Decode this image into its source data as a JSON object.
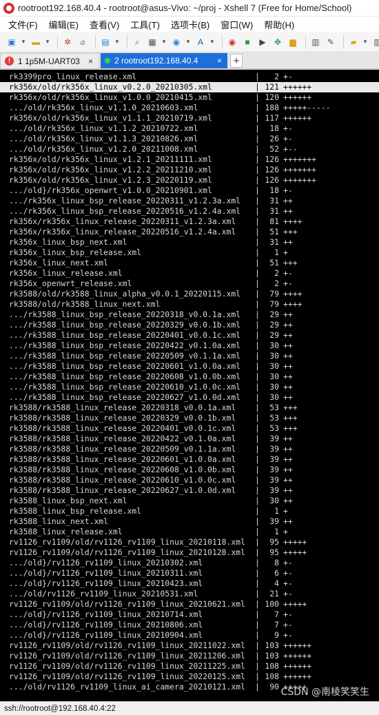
{
  "window": {
    "title": "rootroot192.168.40.4 - rootroot@asus-Vivo: ~/proj - Xshell 7 (Free for Home/School)"
  },
  "menu": [
    "文件(F)",
    "编辑(E)",
    "查看(V)",
    "工具(T)",
    "选项卡(B)",
    "窗口(W)",
    "帮助(H)"
  ],
  "toolbar": [
    {
      "name": "new-session-icon",
      "glyph": "▣",
      "color": "#2e7bcf",
      "caret": true
    },
    {
      "name": "open-folder-icon",
      "glyph": "▬",
      "color": "#e0a020",
      "caret": true
    },
    {
      "sep": true
    },
    {
      "name": "reconnect-icon",
      "glyph": "✲",
      "color": "#c0392b"
    },
    {
      "name": "disconnect-icon",
      "glyph": "⌀",
      "color": "#7f8c8d"
    },
    {
      "sep": true
    },
    {
      "name": "properties-icon",
      "glyph": "▤",
      "color": "#2e7bcf",
      "caret": true
    },
    {
      "sep": true
    },
    {
      "name": "find-icon",
      "glyph": "⌕",
      "color": "#555555"
    },
    {
      "name": "print-icon",
      "glyph": "▦",
      "color": "#555555",
      "caret": true
    },
    {
      "name": "globe-icon",
      "glyph": "◉",
      "color": "#2e86de",
      "caret": true
    },
    {
      "name": "font-icon",
      "glyph": "A",
      "color": "#1a5fb4",
      "caret": true
    },
    {
      "sep": true
    },
    {
      "name": "xshell-icon",
      "glyph": "◉",
      "color": "#d32f2f"
    },
    {
      "name": "xftp-icon",
      "glyph": "■",
      "color": "#2e9d3a"
    },
    {
      "name": "script-icon",
      "glyph": "▶",
      "color": "#444444"
    },
    {
      "name": "fullscreen-icon",
      "glyph": "✥",
      "color": "#1f9d55"
    },
    {
      "name": "lock-icon",
      "glyph": "▆",
      "color": "#e0a020"
    },
    {
      "sep": true
    },
    {
      "name": "keyboard-icon",
      "glyph": "▥",
      "color": "#555555"
    },
    {
      "name": "pen-icon",
      "glyph": "✎",
      "color": "#555555"
    },
    {
      "sep": true
    },
    {
      "name": "add-session-icon",
      "glyph": "▰",
      "color": "#e0a020",
      "caret": true
    },
    {
      "name": "layout-icon",
      "glyph": "▥",
      "color": "#555555",
      "caret": true
    }
  ],
  "tabs": [
    {
      "label": "1 1p5M-UART03",
      "close": "×",
      "warning": "!"
    },
    {
      "label": "2 rootroot192.168.40.4",
      "close": "×"
    }
  ],
  "tab_add": "+",
  "terminal_lines": [
    {
      "path": "rk3399pro_linux_release.xml",
      "count": "2",
      "stat": "+-"
    },
    {
      "path": "rk356x/old/rk356x_linux_v0.2.0_20210305.xml",
      "count": "121",
      "stat": "++++++",
      "highlight": true
    },
    {
      "path": "rk356x/old/rk356x_linux_v1.0.0_20210415.xml",
      "count": "120",
      "stat": "++++++"
    },
    {
      "path": ".../old/rk356x_linux_v1.1.0_20210603.xml",
      "count": "188",
      "stat": "+++++-----"
    },
    {
      "path": "rk356x/old/rk356x_linux_v1.1.1_20210719.xml",
      "count": "117",
      "stat": "++++++"
    },
    {
      "path": ".../old/rk356x_linux_v1.1.2_20210722.xml",
      "count": "18",
      "stat": "+-"
    },
    {
      "path": ".../old/rk356x_linux_v1.1.3_20210826.xml",
      "count": "26",
      "stat": "+-"
    },
    {
      "path": ".../old/rk356x_linux_v1.2.0_20211008.xml",
      "count": "52",
      "stat": "+--"
    },
    {
      "path": "rk356x/old/rk356x_linux_v1.2.1_20211111.xml",
      "count": "126",
      "stat": "+++++++"
    },
    {
      "path": "rk356x/old/rk356x_linux_v1.2.2_20211210.xml",
      "count": "126",
      "stat": "+++++++"
    },
    {
      "path": "rk356x/old/rk356x_linux_v1.2.3_20220119.xml",
      "count": "126",
      "stat": "+++++++"
    },
    {
      "path": ".../old}/rk356x_openwrt_v1.0.0_20210901.xml",
      "count": "18",
      "stat": "+-"
    },
    {
      "path": ".../rk356x_linux_bsp_release_20220311_v1.2.3a.xml",
      "count": "31",
      "stat": "++"
    },
    {
      "path": ".../rk356x_linux_bsp_release_20220516_v1.2.4a.xml",
      "count": "31",
      "stat": "++"
    },
    {
      "path": "rk356x/rk356x_linux_release_20220311_v1.2.3a.xml",
      "count": "81",
      "stat": "++++"
    },
    {
      "path": "rk356x/rk356x_linux_release_20220516_v1.2.4a.xml",
      "count": "51",
      "stat": "+++"
    },
    {
      "path": "rk356x_linux_bsp_next.xml",
      "count": "31",
      "stat": "++"
    },
    {
      "path": "rk356x_linux_bsp_release.xml",
      "count": "1",
      "stat": "+"
    },
    {
      "path": "rk356x_linux_next.xml",
      "count": "51",
      "stat": "+++"
    },
    {
      "path": "rk356x_linux_release.xml",
      "count": "2",
      "stat": "+-"
    },
    {
      "path": "rk356x_openwrt_release.xml",
      "count": "2",
      "stat": "+-"
    },
    {
      "path": "rk3588/old/rk3588_linux_alpha_v0.0.1_20220115.xml",
      "count": "79",
      "stat": "++++"
    },
    {
      "path": "rk3588/old/rk3588_linux_next.xml",
      "count": "79",
      "stat": "++++"
    },
    {
      "path": ".../rk3588_linux_bsp_release_20220318_v0.0.1a.xml",
      "count": "29",
      "stat": "++"
    },
    {
      "path": ".../rk3588_linux_bsp_release_20220329_v0.0.1b.xml",
      "count": "29",
      "stat": "++"
    },
    {
      "path": ".../rk3588_linux_bsp_release_20220401_v0.0.1c.xml",
      "count": "29",
      "stat": "++"
    },
    {
      "path": ".../rk3588_linux_bsp_release_20220422_v0.1.0a.xml",
      "count": "30",
      "stat": "++"
    },
    {
      "path": ".../rk3588_linux_bsp_release_20220509_v0.1.1a.xml",
      "count": "30",
      "stat": "++"
    },
    {
      "path": ".../rk3588_linux_bsp_release_20220601_v1.0.0a.xml",
      "count": "30",
      "stat": "++"
    },
    {
      "path": ".../rk3588_linux_bsp_release_20220608_v1.0.0b.xml",
      "count": "30",
      "stat": "++"
    },
    {
      "path": ".../rk3588_linux_bsp_release_20220610_v1.0.0c.xml",
      "count": "30",
      "stat": "++"
    },
    {
      "path": ".../rk3588_linux_bsp_release_20220627_v1.0.0d.xml",
      "count": "30",
      "stat": "++"
    },
    {
      "path": "rk3588/rk3588_linux_release_20220318_v0.0.1a.xml",
      "count": "53",
      "stat": "+++"
    },
    {
      "path": "rk3588/rk3588_linux_release_20220329_v0.0.1b.xml",
      "count": "53",
      "stat": "+++"
    },
    {
      "path": "rk3588/rk3588_linux_release_20220401_v0.0.1c.xml",
      "count": "53",
      "stat": "+++"
    },
    {
      "path": "rk3588/rk3588_linux_release_20220422_v0.1.0a.xml",
      "count": "39",
      "stat": "++"
    },
    {
      "path": "rk3588/rk3588_linux_release_20220509_v0.1.1a.xml",
      "count": "39",
      "stat": "++"
    },
    {
      "path": "rk3588/rk3588_linux_release_20220601_v1.0.0a.xml",
      "count": "39",
      "stat": "++"
    },
    {
      "path": "rk3588/rk3588_linux_release_20220608_v1.0.0b.xml",
      "count": "39",
      "stat": "++"
    },
    {
      "path": "rk3588/rk3588_linux_release_20220610_v1.0.0c.xml",
      "count": "39",
      "stat": "++"
    },
    {
      "path": "rk3588/rk3588_linux_release_20220627_v1.0.0d.xml",
      "count": "39",
      "stat": "++"
    },
    {
      "path": "rk3588_linux_bsp_next.xml",
      "count": "30",
      "stat": "++"
    },
    {
      "path": "rk3588_linux_bsp_release.xml",
      "count": "1",
      "stat": "+"
    },
    {
      "path": "rk3588_linux_next.xml",
      "count": "39",
      "stat": "++"
    },
    {
      "path": "rk3588_linux_release.xml",
      "count": "1",
      "stat": "+"
    },
    {
      "path": "rv1126_rv1109/old/rv1126_rv1109_linux_20210118.xml",
      "count": "95",
      "stat": "+++++"
    },
    {
      "path": "rv1126_rv1109/old/rv1126_rv1109_linux_20210128.xml",
      "count": "95",
      "stat": "+++++"
    },
    {
      "path": ".../old}/rv1126_rv1109_linux_20210302.xml",
      "count": "8",
      "stat": "+-"
    },
    {
      "path": ".../old}/rv1126_rv1109_linux_20210311.xml",
      "count": "6",
      "stat": "+-"
    },
    {
      "path": ".../old}/rv1126_rv1109_linux_20210423.xml",
      "count": "4",
      "stat": "+-"
    },
    {
      "path": ".../old/rv1126_rv1109_linux_20210531.xml",
      "count": "21",
      "stat": "+-"
    },
    {
      "path": "rv1126_rv1109/old/rv1126_rv1109_linux_20210621.xml",
      "count": "100",
      "stat": "+++++"
    },
    {
      "path": ".../old}/rv1126_rv1109_linux_20210714.xml",
      "count": "7",
      "stat": "+-"
    },
    {
      "path": ".../old}/rv1126_rv1109_linux_20210806.xml",
      "count": "7",
      "stat": "+-"
    },
    {
      "path": ".../old}/rv1126_rv1109_linux_20210904.xml",
      "count": "9",
      "stat": "+-"
    },
    {
      "path": "rv1126_rv1109/old/rv1126_rv1109_linux_20211022.xml",
      "count": "103",
      "stat": "++++++"
    },
    {
      "path": "rv1126_rv1109/old/rv1126_rv1109_linux_20211206.xml",
      "count": "103",
      "stat": "++++++"
    },
    {
      "path": "rv1126_rv1109/old/rv1126_rv1109_linux_20211225.xml",
      "count": "108",
      "stat": "++++++"
    },
    {
      "path": "rv1126_rv1109/old/rv1126_rv1109_linux_20220125.xml",
      "count": "108",
      "stat": "++++++"
    },
    {
      "path": ".../old/rv1126_rv1109_linux_ai_camera_20210121.xml",
      "count": "90",
      "stat": "+++++"
    }
  ],
  "terminal_separator": "|",
  "watermark": "CSDN @南棱笑笑生",
  "status": {
    "text": "ssh://rootroot@192.168.40.4:22"
  }
}
